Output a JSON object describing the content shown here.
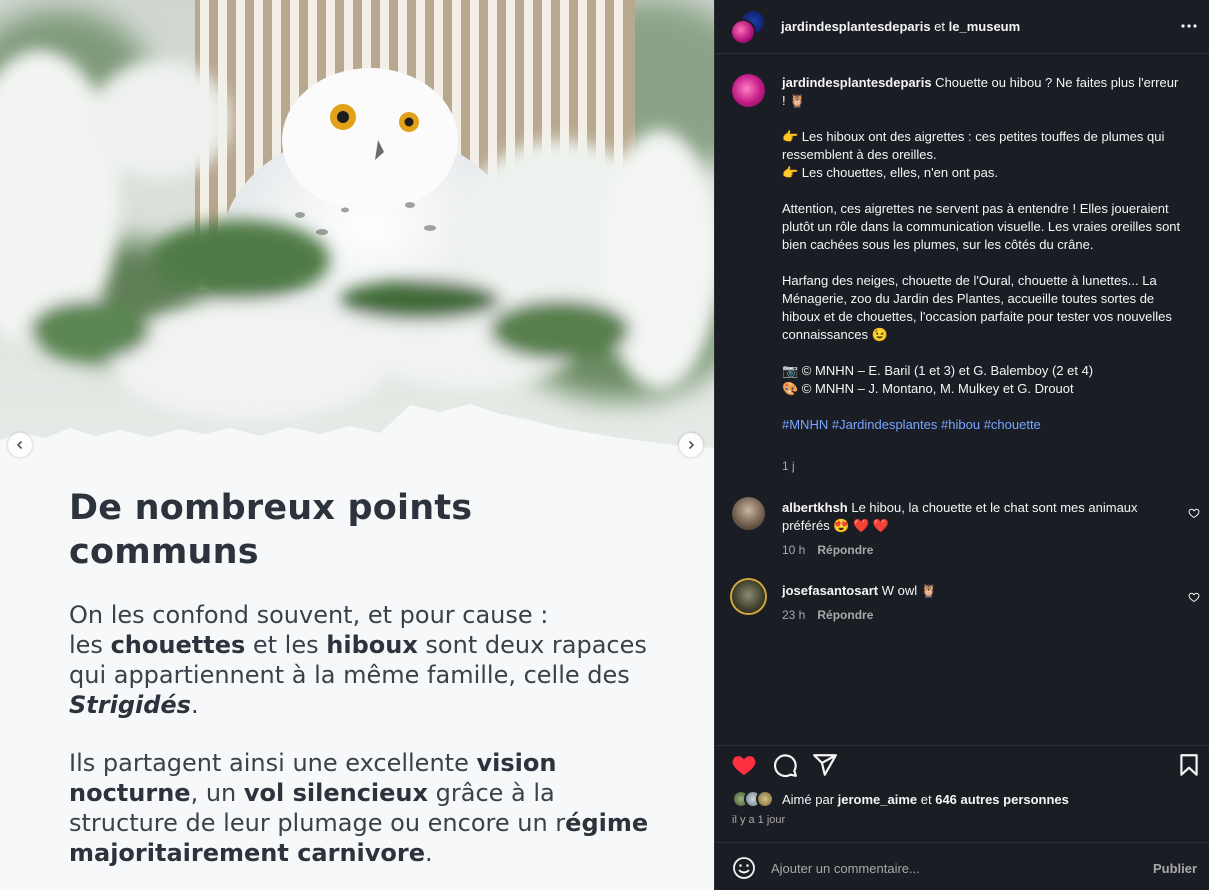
{
  "slide": {
    "title": "De nombreux points communs",
    "p1_l1": "On les confond souvent, et pour cause :",
    "p1_pre": "les ",
    "p1_b1": "chouettes",
    "p1_mid": " et les ",
    "p1_b2": "hiboux",
    "p1_post": " sont deux rapaces qui appartiennent à la même famille, celle des ",
    "p1_i": "Strigidés",
    "p1_end": ".",
    "p2_pre": "Ils partagent ainsi une excellente ",
    "p2_b1": "vision nocturne",
    "p2_mid1": ", un ",
    "p2_b2": "vol silencieux",
    "p2_mid2": " grâce à la structure de leur plumage ou encore un r",
    "p2_b3": "égime majoritairement carnivore",
    "p2_end": "."
  },
  "header": {
    "user1": "jardindesplantesdeparis",
    "joiner": " et ",
    "user2": "le_museum"
  },
  "caption": {
    "user": "jardindesplantesdeparis",
    "line1": " Chouette ou hibou ? Ne faites plus l'erreur ! 🦉",
    "line2": "👉 Les hiboux ont des aigrettes : ces petites touffes de plumes qui ressemblent à des oreilles.",
    "line3": "👉 Les chouettes, elles, n'en ont pas.",
    "line4": "Attention, ces aigrettes ne servent pas à entendre ! Elles joueraient plutôt un rôle dans la communication visuelle. Les vraies oreilles sont bien cachées sous les plumes, sur les côtés du crâne.",
    "line5": "Harfang des neiges, chouette de l'Oural, chouette à lunettes... La Ménagerie, zoo du Jardin des Plantes, accueille toutes sortes de hiboux et de chouettes, l'occasion parfaite pour tester vos nouvelles connaissances 😉",
    "line6": "📷 © MNHN – E. Baril (1 et 3) et G. Balemboy (2 et 4)",
    "line7": "🎨 © MNHN – J. Montano, M. Mulkey et G. Drouot",
    "hashtags": [
      "#MNHN",
      "#Jardindesplantes",
      "#hibou",
      "#chouette"
    ],
    "time": "1 j"
  },
  "comments": [
    {
      "user": "albertkhsh",
      "text": " Le hibou, la chouette et le chat sont mes animaux préférés 😍 ❤️ ❤️",
      "time": "10 h",
      "reply": "Répondre"
    },
    {
      "user": "josefasantosart",
      "text": " W owl 🦉",
      "time": "23 h",
      "reply": "Répondre"
    }
  ],
  "likes": {
    "prefix": "Aimé par ",
    "user": "jerome_aime",
    "mid": " et ",
    "others": "646 autres personnes",
    "when": "il y a 1 jour"
  },
  "composer": {
    "placeholder": "Ajouter un commentaire...",
    "publish": "Publier"
  },
  "colors": {
    "panel_bg": "#1a1d24",
    "like_red": "#ff3040",
    "hashtag_blue": "#7aa6ff"
  }
}
